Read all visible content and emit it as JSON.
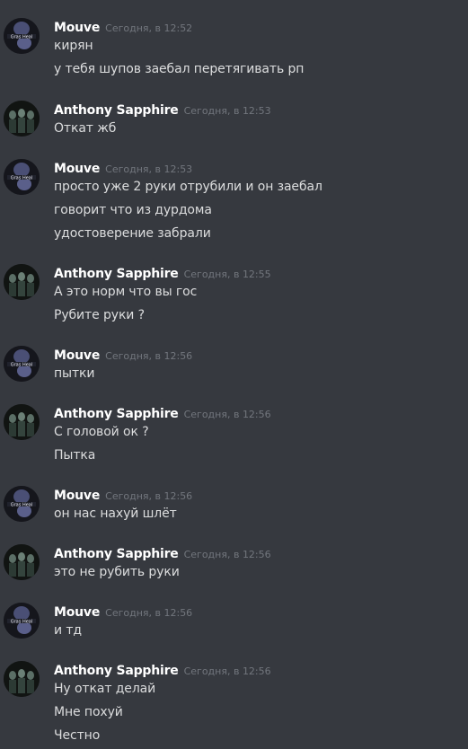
{
  "messages": [
    {
      "author": "Mouve",
      "time": "Сегодня, в 12:52",
      "avatar": "mouve",
      "lines": [
        "кирян",
        "у тебя шупов заебал перетягивать рп"
      ]
    },
    {
      "author": "Anthony Sapphire",
      "time": "Сегодня, в 12:53",
      "avatar": "anthony",
      "lines": [
        "Откат жб"
      ]
    },
    {
      "author": "Mouve",
      "time": "Сегодня, в 12:53",
      "avatar": "mouve",
      "lines": [
        "просто уже 2 руки отрубили и он заебал",
        "говорит что из дурдома",
        "удостоверение забрали"
      ]
    },
    {
      "author": "Anthony Sapphire",
      "time": "Сегодня, в 12:55",
      "avatar": "anthony",
      "lines": [
        "А это норм что вы гос",
        "Рубите руки ?"
      ]
    },
    {
      "author": "Mouve",
      "time": "Сегодня, в 12:56",
      "avatar": "mouve",
      "lines": [
        "пытки"
      ]
    },
    {
      "author": "Anthony Sapphire",
      "time": "Сегодня, в 12:56",
      "avatar": "anthony",
      "lines": [
        "С головой ок ?",
        "Пытка"
      ]
    },
    {
      "author": "Mouve",
      "time": "Сегодня, в 12:56",
      "avatar": "mouve",
      "lines": [
        "он нас нахуй шлёт"
      ]
    },
    {
      "author": "Anthony Sapphire",
      "time": "Сегодня, в 12:56",
      "avatar": "anthony",
      "lines": [
        "это не рубить руки"
      ]
    },
    {
      "author": "Mouve",
      "time": "Сегодня, в 12:56",
      "avatar": "mouve",
      "lines": [
        "и тд"
      ]
    },
    {
      "author": "Anthony Sapphire",
      "time": "Сегодня, в 12:56",
      "avatar": "anthony",
      "lines": [
        "Ну откат делай",
        "Мне похуй",
        "Честно"
      ]
    }
  ],
  "colors": {
    "background": "#36393f",
    "author": "#ffffff",
    "timestamp": "#72767d",
    "text": "#dcddde"
  }
}
